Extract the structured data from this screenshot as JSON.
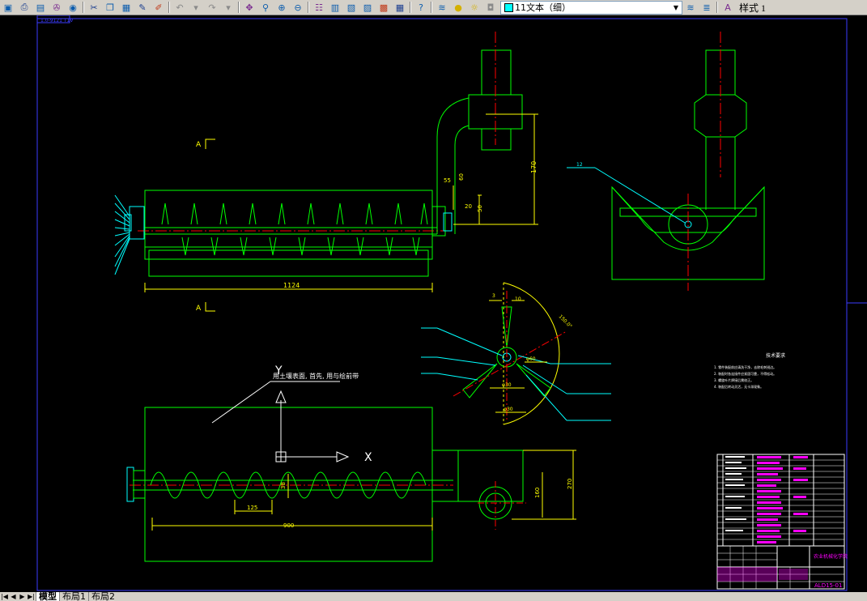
{
  "toolbar": {
    "layer_name": "11文本（细）",
    "style_name": "样式 1",
    "colors": {
      "layer_square": "#00ffff"
    }
  },
  "drawing": {
    "view_label_a_top": "A",
    "view_label_a_bottom": "A",
    "overall_length": "1124",
    "height_dim": "170",
    "dim_20": "20",
    "dim_50": "50",
    "dim_55": "55",
    "dim_60": "60",
    "pitch": "125",
    "length_900": "900",
    "height_270": "270",
    "dim_160": "160",
    "dim_38": "38",
    "section_dims": [
      "3",
      "10",
      "φ60",
      "φ30",
      "φ30",
      "150.0°"
    ],
    "note_top": "用土壤表面, 首先, 用与绘前带",
    "tech_req_title": "技术要求",
    "tech_req_lines": [
      "1. 零件装配前应清洗干净，去除毛刺锐边。",
      "2. 装配时各连接件应紧固可靠，不得松动。",
      "3. 螺旋叶片焊接后需校正。",
      "4. 装配后转动灵活，无卡滞现象。"
    ],
    "title_block_label": "农业机械化学院",
    "drawing_no": "ALD15-01",
    "ucs_x": "X",
    "ucs_y": "Y",
    "header_tag": "1.0-9121 T1V"
  },
  "tabs": [
    {
      "label": "模型",
      "active": true
    },
    {
      "label": "布局1",
      "active": false
    },
    {
      "label": "布局2",
      "active": false
    }
  ],
  "colors": {
    "green": "#00ff00",
    "yellow": "#ffff00",
    "cyan": "#00ffff",
    "red": "#ff0000",
    "magenta": "#ff00ff",
    "white": "#ffffff",
    "blue": "#0000ff",
    "canvas": "#000000"
  }
}
